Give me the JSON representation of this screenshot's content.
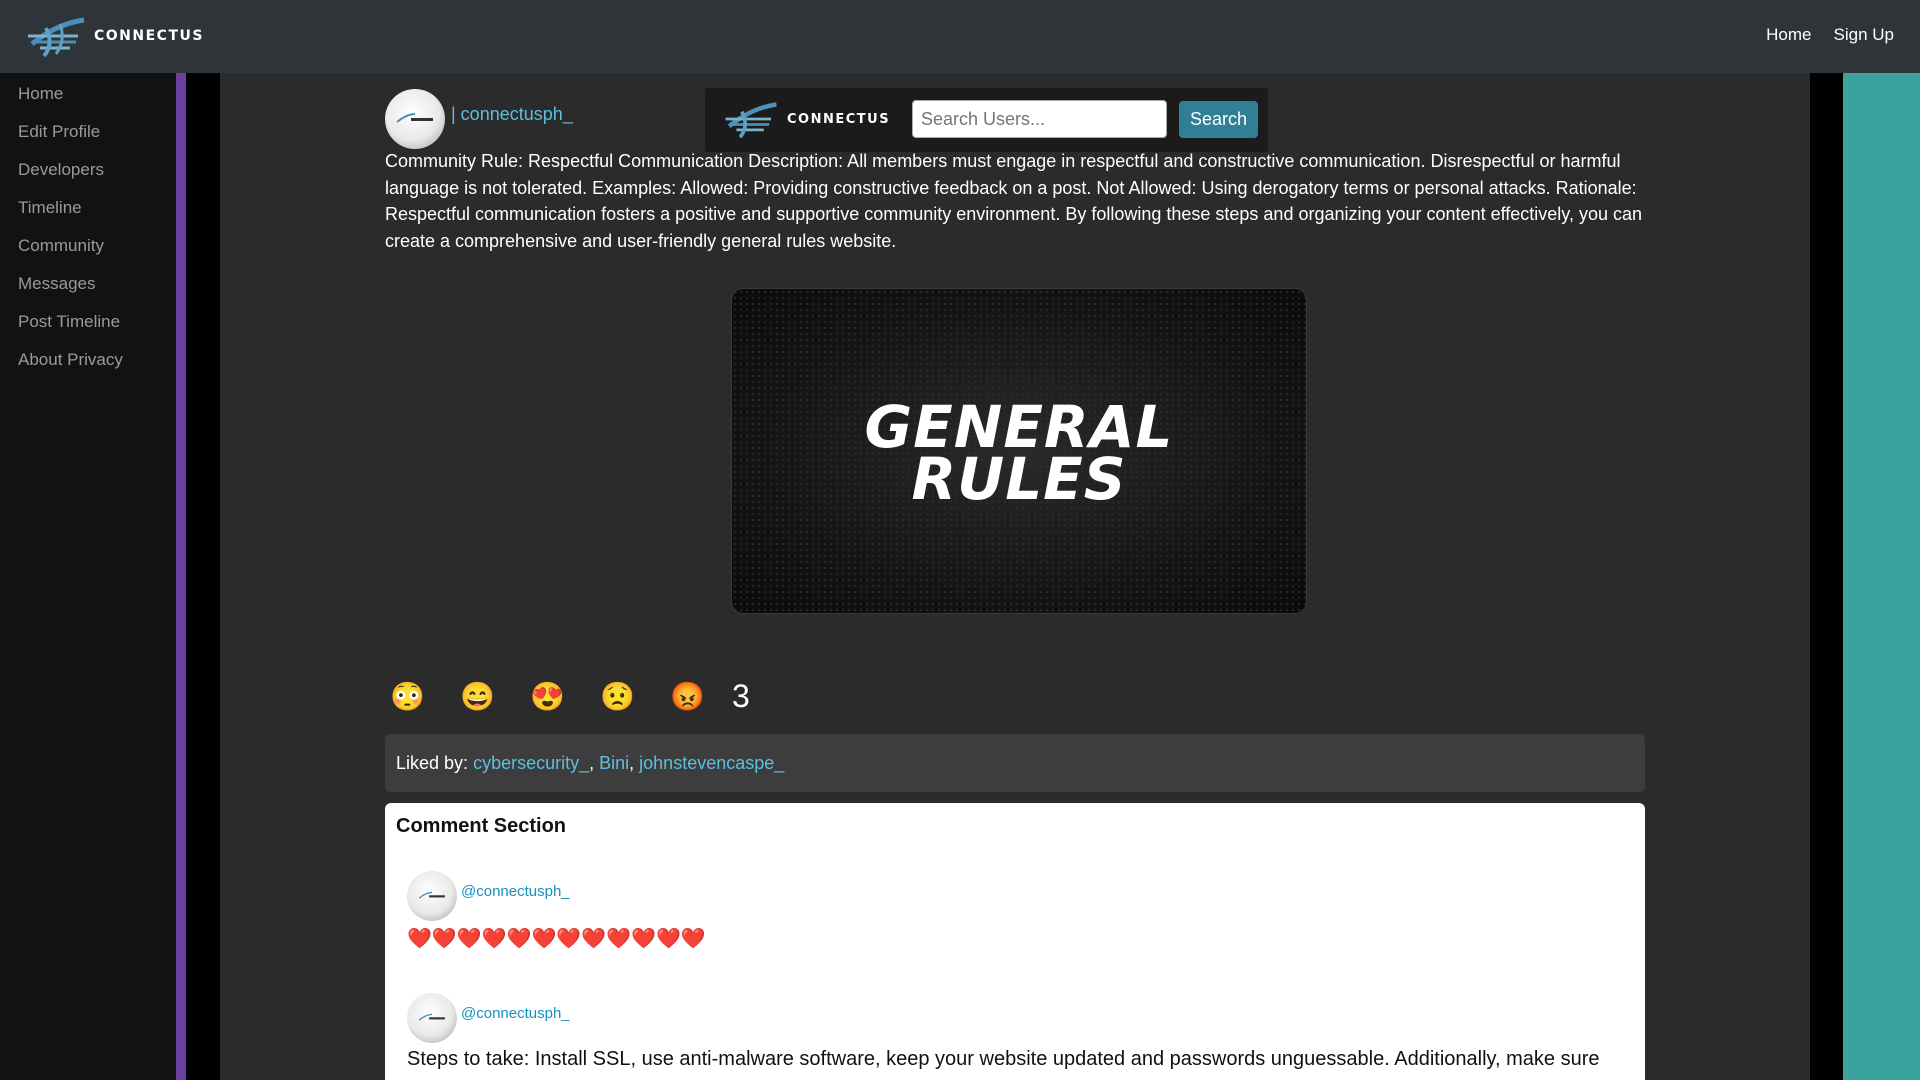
{
  "header": {
    "brand": "CONNECTUS",
    "nav": [
      {
        "label": "Home"
      },
      {
        "label": "Sign Up"
      }
    ]
  },
  "sidebar": {
    "items": [
      {
        "label": "Home"
      },
      {
        "label": "Edit Profile"
      },
      {
        "label": "Developers"
      },
      {
        "label": "Timeline"
      },
      {
        "label": "Community"
      },
      {
        "label": "Messages"
      },
      {
        "label": "Post Timeline"
      },
      {
        "label": "About Privacy"
      }
    ]
  },
  "search": {
    "brand": "CONNECTUS",
    "placeholder": "Search Users...",
    "button_label": "Search"
  },
  "post": {
    "author": "| connectusph_",
    "text": "Community Rule: Respectful Communication Description: All members must engage in respectful and constructive communication. Disrespectful or harmful language is not tolerated. Examples: Allowed: Providing constructive feedback on a post. Not Allowed: Using derogatory terms or personal attacks. Rationale: Respectful communication fosters a positive and supportive community environment. By following these steps and organizing your content effectively, you can create a comprehensive and user-friendly general rules website.",
    "image_title_line1": "GENERAL",
    "image_title_line2": "RULES",
    "reactions": [
      {
        "icon": "wow-face-icon",
        "glyph": "😳"
      },
      {
        "icon": "grin-face-icon",
        "glyph": "😄"
      },
      {
        "icon": "heart-eyes-icon",
        "glyph": "😍"
      },
      {
        "icon": "sad-face-icon",
        "glyph": "😟"
      },
      {
        "icon": "angry-face-icon",
        "glyph": "😡"
      }
    ],
    "reaction_count": "3",
    "liked_by_label": "Liked by:",
    "liked_by": [
      "cybersecurity_",
      "Bini",
      "johnstevencaspe_"
    ]
  },
  "comments": {
    "title": "Comment Section",
    "items": [
      {
        "user": "@connectusph_",
        "text": "❤️❤️❤️❤️❤️❤️❤️❤️❤️❤️❤️❤️"
      },
      {
        "user": "@connectusph_",
        "text": "Steps to take: Install SSL, use anti-malware software, keep your website updated and passwords unguessable. Additionally, make sure"
      }
    ]
  },
  "colors": {
    "topbar": "#2f3438",
    "sidebar": "#121212",
    "accent_purple": "#6b3f9e",
    "accent_teal": "#3aa39e",
    "link": "#5bc0de",
    "search_button": "#2f7f97"
  }
}
